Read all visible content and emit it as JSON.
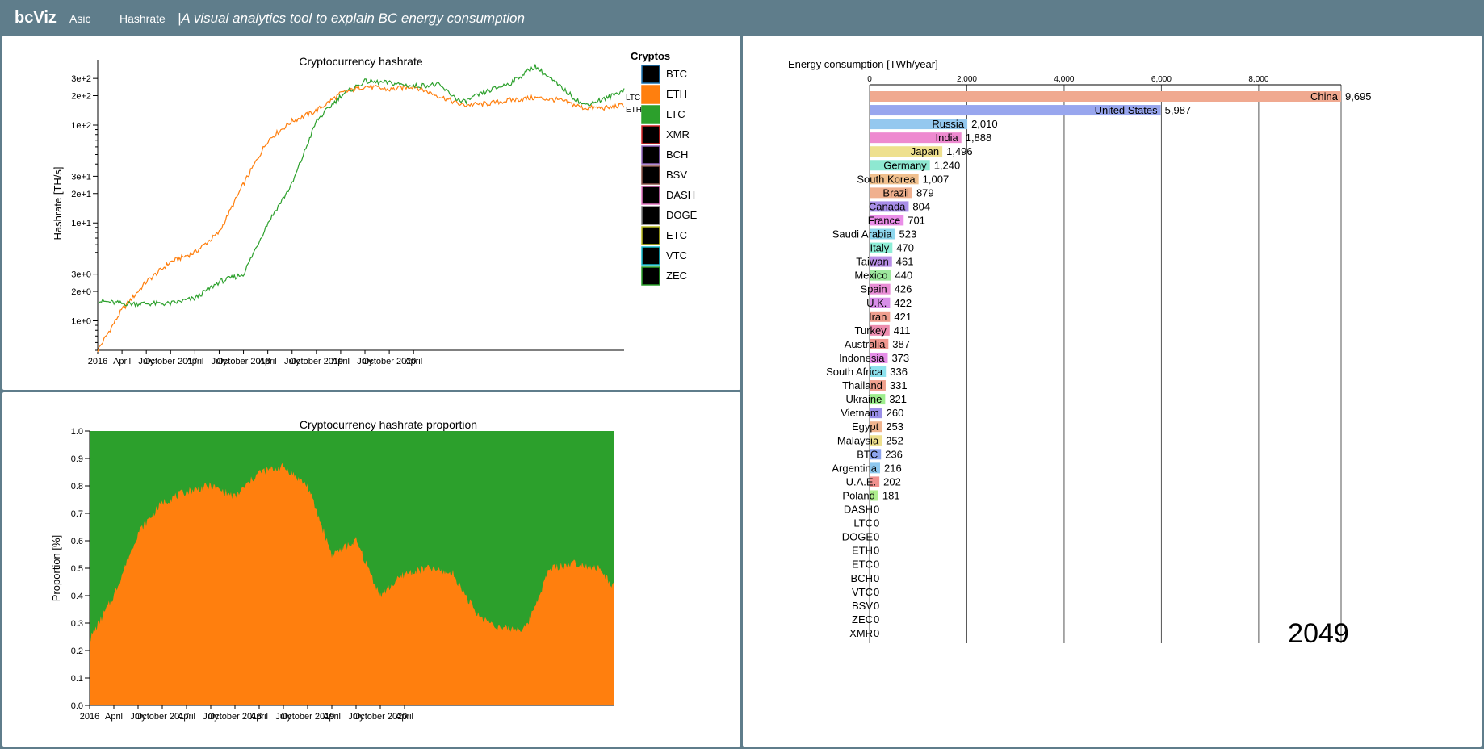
{
  "app": {
    "brand": "bcViz",
    "nav": [
      "Asic",
      "Hashrate"
    ],
    "tagline": "|A visual analytics tool to explain BC energy consumption"
  },
  "colors": {
    "btc": "#1f77b4",
    "eth": "#ff7f0e",
    "ltc": "#2ca02c",
    "xmr": "#d62728",
    "bch": "#9467bd",
    "bsv": "#8c564b",
    "dash": "#e377c2",
    "doge": "#7f7f7f",
    "etc": "#bcbd22",
    "vtc": "#17becf",
    "zec": "#2ca02c"
  },
  "hashrate_chart": {
    "title": "Cryptocurrency hashrate",
    "ylabel": "Hashrate [TH/s]",
    "x_ticks": [
      "2016",
      "April",
      "July",
      "October 2017",
      "April",
      "July",
      "October 2018",
      "April",
      "July",
      "October 2019",
      "April",
      "July",
      "October 2020",
      "April"
    ],
    "y_ticks": [
      "1e+0",
      "2e+0",
      "3e+0",
      "1e+1",
      "2e+1",
      "3e+1",
      "1e+2",
      "2e+2",
      "3e+2"
    ],
    "legend_title": "Cryptos",
    "legend": [
      {
        "name": "BTC",
        "color": "#1f77b4"
      },
      {
        "name": "ETH",
        "color": "#ff7f0e"
      },
      {
        "name": "LTC",
        "color": "#2ca02c"
      },
      {
        "name": "XMR",
        "color": "#d62728"
      },
      {
        "name": "BCH",
        "color": "#9467bd"
      },
      {
        "name": "BSV",
        "color": "#8c564b"
      },
      {
        "name": "DASH",
        "color": "#e377c2"
      },
      {
        "name": "DOGE",
        "color": "#7f7f7f"
      },
      {
        "name": "ETC",
        "color": "#bcbd22"
      },
      {
        "name": "VTC",
        "color": "#17becf"
      },
      {
        "name": "ZEC",
        "color": "#2ca02c"
      }
    ],
    "end_labels": [
      "LTC",
      "ETH"
    ]
  },
  "proportion_chart": {
    "title": "Cryptocurrency hashrate proportion",
    "ylabel": "Proportion [%]",
    "y_ticks": [
      "0.0",
      "0.1",
      "0.2",
      "0.3",
      "0.4",
      "0.5",
      "0.6",
      "0.7",
      "0.8",
      "0.9",
      "1.0"
    ],
    "x_ticks": [
      "2016",
      "April",
      "July",
      "October 2017",
      "April",
      "July",
      "October 2018",
      "April",
      "July",
      "October 2019",
      "April",
      "July",
      "October 2020",
      "April"
    ]
  },
  "energy_chart": {
    "title": "Energy consumption [TWh/year]",
    "x_ticks": [
      "0",
      "2,000",
      "4,000",
      "6,000",
      "8,000"
    ],
    "year": "2049",
    "bars": [
      {
        "label": "China",
        "value": 9695,
        "value_label": "9,695",
        "color": "#f0a990"
      },
      {
        "label": "United States",
        "value": 5987,
        "value_label": "5,987",
        "color": "#98a6ee"
      },
      {
        "label": "Russia",
        "value": 2010,
        "value_label": "2,010",
        "color": "#94c8ef"
      },
      {
        "label": "India",
        "value": 1888,
        "value_label": "1,888",
        "color": "#ee8ad0"
      },
      {
        "label": "Japan",
        "value": 1496,
        "value_label": "1,496",
        "color": "#eee08e"
      },
      {
        "label": "Germany",
        "value": 1240,
        "value_label": "1,240",
        "color": "#8ee8d1"
      },
      {
        "label": "South Korea",
        "value": 1007,
        "value_label": "1,007",
        "color": "#f0c08e"
      },
      {
        "label": "Brazil",
        "value": 879,
        "value_label": "879",
        "color": "#f0b08e"
      },
      {
        "label": "Canada",
        "value": 804,
        "value_label": "804",
        "color": "#a88ee8"
      },
      {
        "label": "France",
        "value": 701,
        "value_label": "701",
        "color": "#ea8ee8"
      },
      {
        "label": "Saudi Arabia",
        "value": 523,
        "value_label": "523",
        "color": "#8ed7ee"
      },
      {
        "label": "Italy",
        "value": 470,
        "value_label": "470",
        "color": "#8eeed7"
      },
      {
        "label": "Taiwan",
        "value": 461,
        "value_label": "461",
        "color": "#b88ee8"
      },
      {
        "label": "Mexico",
        "value": 440,
        "value_label": "440",
        "color": "#9ee89e"
      },
      {
        "label": "Spain",
        "value": 426,
        "value_label": "426",
        "color": "#e88ed6"
      },
      {
        "label": "U.K.",
        "value": 422,
        "value_label": "422",
        "color": "#d88ee8"
      },
      {
        "label": "Iran",
        "value": 421,
        "value_label": "421",
        "color": "#ee9e8e"
      },
      {
        "label": "Turkey",
        "value": 411,
        "value_label": "411",
        "color": "#ee8eb0"
      },
      {
        "label": "Australia",
        "value": 387,
        "value_label": "387",
        "color": "#f09890"
      },
      {
        "label": "Indonesia",
        "value": 373,
        "value_label": "373",
        "color": "#e68ee8"
      },
      {
        "label": "South Africa",
        "value": 336,
        "value_label": "336",
        "color": "#8ee2ee"
      },
      {
        "label": "Thailand",
        "value": 331,
        "value_label": "331",
        "color": "#f0a08e"
      },
      {
        "label": "Ukraine",
        "value": 321,
        "value_label": "321",
        "color": "#9eee8e"
      },
      {
        "label": "Vietnam",
        "value": 260,
        "value_label": "260",
        "color": "#9a8ee8"
      },
      {
        "label": "Egypt",
        "value": 253,
        "value_label": "253",
        "color": "#f0b48e"
      },
      {
        "label": "Malaysia",
        "value": 252,
        "value_label": "252",
        "color": "#eee08e"
      },
      {
        "label": "BTC",
        "value": 236,
        "value_label": "236",
        "color": "#8ea4ee"
      },
      {
        "label": "Argentina",
        "value": 216,
        "value_label": "216",
        "color": "#8ec8ee"
      },
      {
        "label": "U.A.E.",
        "value": 202,
        "value_label": "202",
        "color": "#f0908e"
      },
      {
        "label": "Poland",
        "value": 181,
        "value_label": "181",
        "color": "#aeee8e"
      },
      {
        "label": "DASH",
        "value": 0,
        "value_label": "0",
        "color": "#ee8ed0"
      },
      {
        "label": "LTC",
        "value": 0,
        "value_label": "0",
        "color": "#9ee89e"
      },
      {
        "label": "DOGE",
        "value": 0,
        "value_label": "0",
        "color": "#bbbbbb"
      },
      {
        "label": "ETH",
        "value": 0,
        "value_label": "0",
        "color": "#f0b08e"
      },
      {
        "label": "ETC",
        "value": 0,
        "value_label": "0",
        "color": "#e0e08e"
      },
      {
        "label": "BCH",
        "value": 0,
        "value_label": "0",
        "color": "#b89ee8"
      },
      {
        "label": "VTC",
        "value": 0,
        "value_label": "0",
        "color": "#8ee2ee"
      },
      {
        "label": "BSV",
        "value": 0,
        "value_label": "0",
        "color": "#c8a090"
      },
      {
        "label": "ZEC",
        "value": 0,
        "value_label": "0",
        "color": "#9ee89e"
      },
      {
        "label": "XMR",
        "value": 0,
        "value_label": "0",
        "color": "#f09090"
      }
    ]
  },
  "chart_data": [
    {
      "type": "line",
      "title": "Cryptocurrency hashrate",
      "xlabel": "",
      "ylabel": "Hashrate [TH/s]",
      "y_scale": "log",
      "x": [
        "2016-01",
        "2016-04",
        "2016-07",
        "2016-10",
        "2017-01",
        "2017-04",
        "2017-07",
        "2017-10",
        "2018-01",
        "2018-04",
        "2018-07",
        "2018-10",
        "2019-01",
        "2019-04",
        "2019-07",
        "2019-10",
        "2020-01",
        "2020-04",
        "2020-07",
        "2020-10",
        "2021-01",
        "2021-04",
        "2021-06"
      ],
      "series": [
        {
          "name": "ETH",
          "values": [
            0.5,
            1.3,
            2.5,
            4,
            5,
            8,
            25,
            70,
            110,
            140,
            210,
            250,
            230,
            250,
            200,
            160,
            165,
            180,
            190,
            180,
            150,
            150,
            160
          ]
        },
        {
          "name": "LTC",
          "values": [
            1.6,
            1.5,
            1.5,
            1.5,
            1.7,
            2.5,
            3,
            10,
            25,
            110,
            200,
            280,
            270,
            250,
            260,
            170,
            220,
            270,
            400,
            250,
            160,
            190,
            230
          ]
        }
      ],
      "grid": false,
      "legend_position": "right"
    },
    {
      "type": "area",
      "title": "Cryptocurrency hashrate proportion",
      "xlabel": "",
      "ylabel": "Proportion [%]",
      "ylim": [
        0,
        1
      ],
      "x": [
        "2016-01",
        "2016-04",
        "2016-07",
        "2016-10",
        "2017-01",
        "2017-04",
        "2017-07",
        "2017-10",
        "2018-01",
        "2018-04",
        "2018-07",
        "2018-10",
        "2019-01",
        "2019-04",
        "2019-07",
        "2019-10",
        "2020-01",
        "2020-04",
        "2020-07",
        "2020-10",
        "2021-01",
        "2021-04",
        "2021-06"
      ],
      "series": [
        {
          "name": "ETH",
          "values": [
            0.24,
            0.4,
            0.63,
            0.74,
            0.78,
            0.8,
            0.76,
            0.85,
            0.87,
            0.8,
            0.55,
            0.6,
            0.4,
            0.48,
            0.5,
            0.48,
            0.33,
            0.28,
            0.28,
            0.5,
            0.52,
            0.5,
            0.43
          ]
        },
        {
          "name": "LTC",
          "values": [
            0.76,
            0.6,
            0.37,
            0.26,
            0.22,
            0.2,
            0.24,
            0.15,
            0.13,
            0.2,
            0.45,
            0.4,
            0.6,
            0.52,
            0.5,
            0.52,
            0.67,
            0.72,
            0.72,
            0.5,
            0.48,
            0.5,
            0.57
          ]
        }
      ],
      "grid": false
    },
    {
      "type": "bar",
      "orientation": "horizontal",
      "title": "Energy consumption [TWh/year]",
      "xlim": [
        0,
        9695
      ],
      "categories": [
        "China",
        "United States",
        "Russia",
        "India",
        "Japan",
        "Germany",
        "South Korea",
        "Brazil",
        "Canada",
        "France",
        "Saudi Arabia",
        "Italy",
        "Taiwan",
        "Mexico",
        "Spain",
        "U.K.",
        "Iran",
        "Turkey",
        "Australia",
        "Indonesia",
        "South Africa",
        "Thailand",
        "Ukraine",
        "Vietnam",
        "Egypt",
        "Malaysia",
        "BTC",
        "Argentina",
        "U.A.E.",
        "Poland",
        "DASH",
        "LTC",
        "DOGE",
        "ETH",
        "ETC",
        "BCH",
        "VTC",
        "BSV",
        "ZEC",
        "XMR"
      ],
      "values": [
        9695,
        5987,
        2010,
        1888,
        1496,
        1240,
        1007,
        879,
        804,
        701,
        523,
        470,
        461,
        440,
        426,
        422,
        421,
        411,
        387,
        373,
        336,
        331,
        321,
        260,
        253,
        252,
        236,
        216,
        202,
        181,
        0,
        0,
        0,
        0,
        0,
        0,
        0,
        0,
        0,
        0
      ],
      "annotation": "2049",
      "grid": true
    }
  ]
}
